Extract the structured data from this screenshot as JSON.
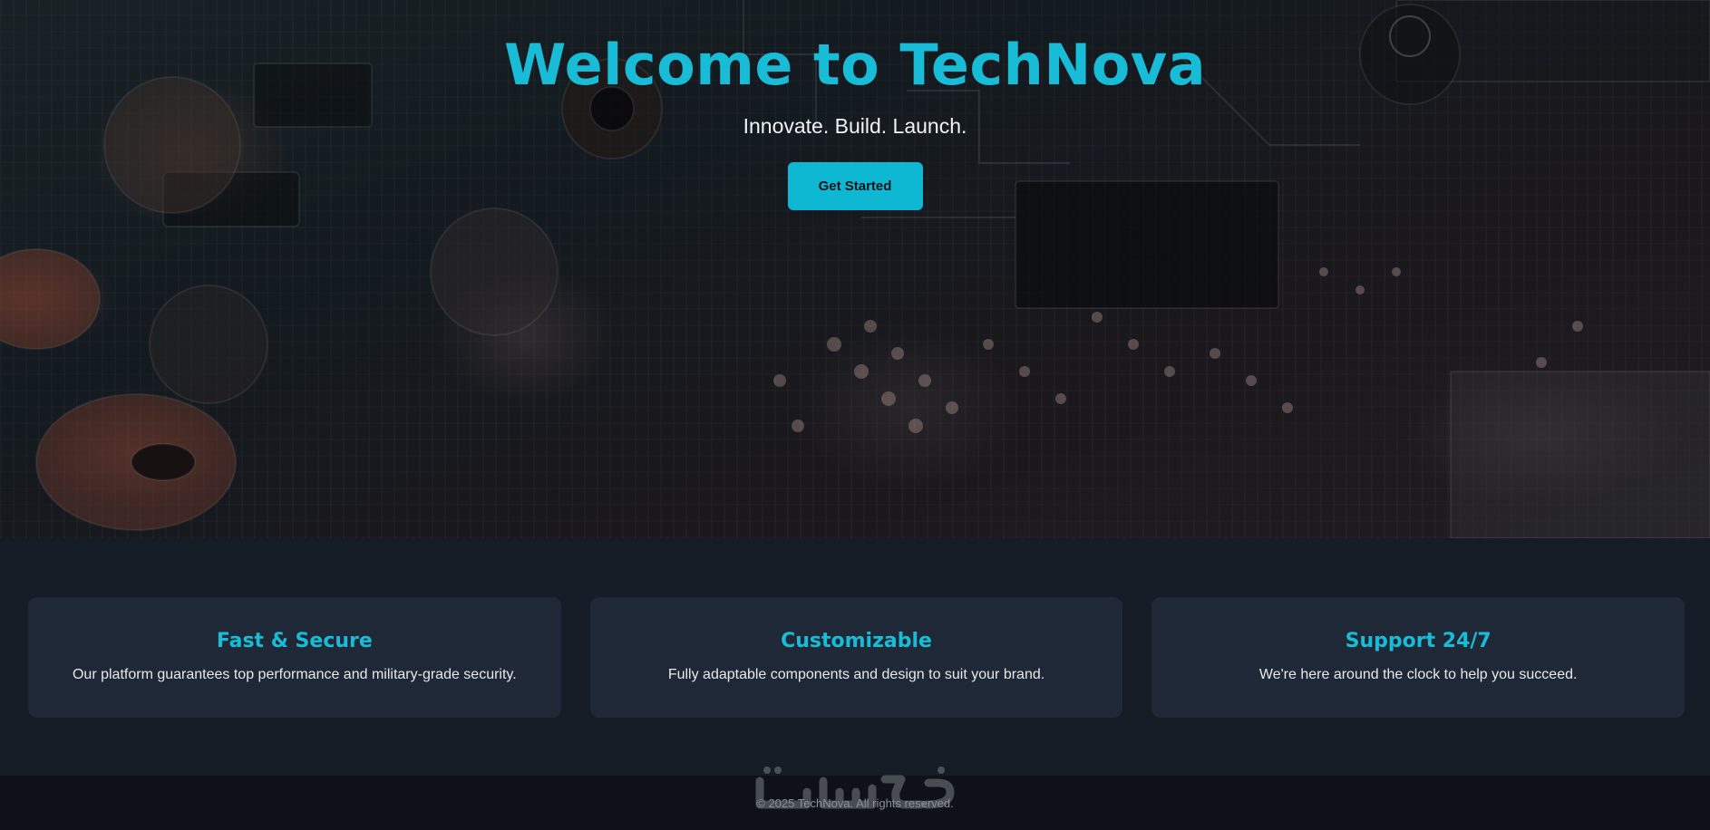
{
  "hero": {
    "title": "Welcome to TechNova",
    "subtitle": "Innovate. Build. Launch.",
    "cta_label": "Get Started"
  },
  "features": [
    {
      "title": "Fast & Secure",
      "description": "Our platform guarantees top performance and military-grade security."
    },
    {
      "title": "Customizable",
      "description": "Fully adaptable components and design to suit your brand."
    },
    {
      "title": "Support 24/7",
      "description": "We're here around the clock to help you succeed."
    }
  ],
  "footer": {
    "copyright": "© 2025 TechNova. All rights reserved.",
    "watermark_text": "خمسات"
  },
  "colors": {
    "accent": "#19bcd6",
    "button": "#0fb8d2",
    "card_bg": "#1f2836",
    "section_bg": "#161c26",
    "footer_bg": "#0e1218"
  },
  "icons": {
    "watermark": "khamsat-logo-icon"
  }
}
